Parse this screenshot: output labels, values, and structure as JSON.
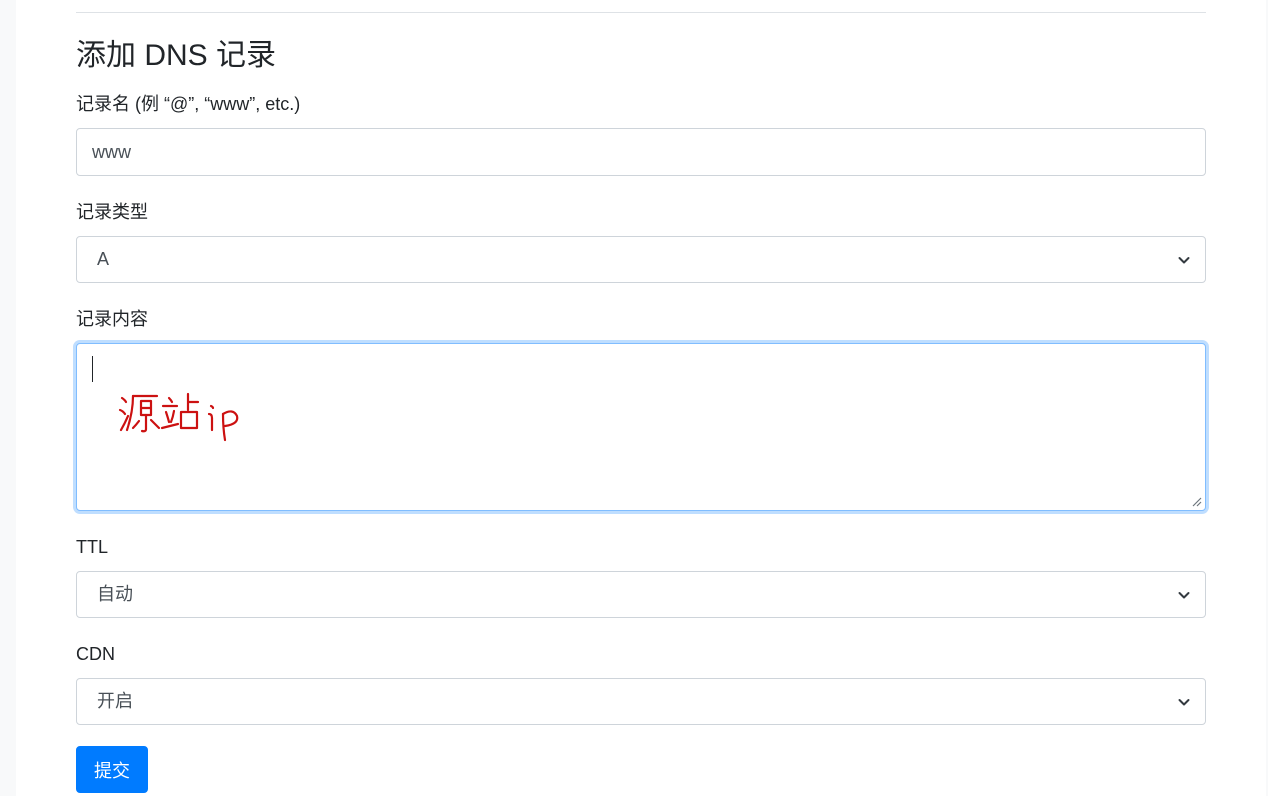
{
  "form": {
    "title": "添加 DNS 记录",
    "record_name": {
      "label": "记录名 (例 “@”, “www”, etc.)",
      "value": "www"
    },
    "record_type": {
      "label": "记录类型",
      "selected": "A"
    },
    "record_content": {
      "label": "记录内容",
      "value": "",
      "handwritten_annotation": "源站ip"
    },
    "ttl": {
      "label": "TTL",
      "selected": "自动"
    },
    "cdn": {
      "label": "CDN",
      "selected": "开启"
    },
    "submit_label": "提交"
  },
  "colors": {
    "accent": "#007bff",
    "focus_border": "#80bdff",
    "annotation": "#cc1111"
  }
}
